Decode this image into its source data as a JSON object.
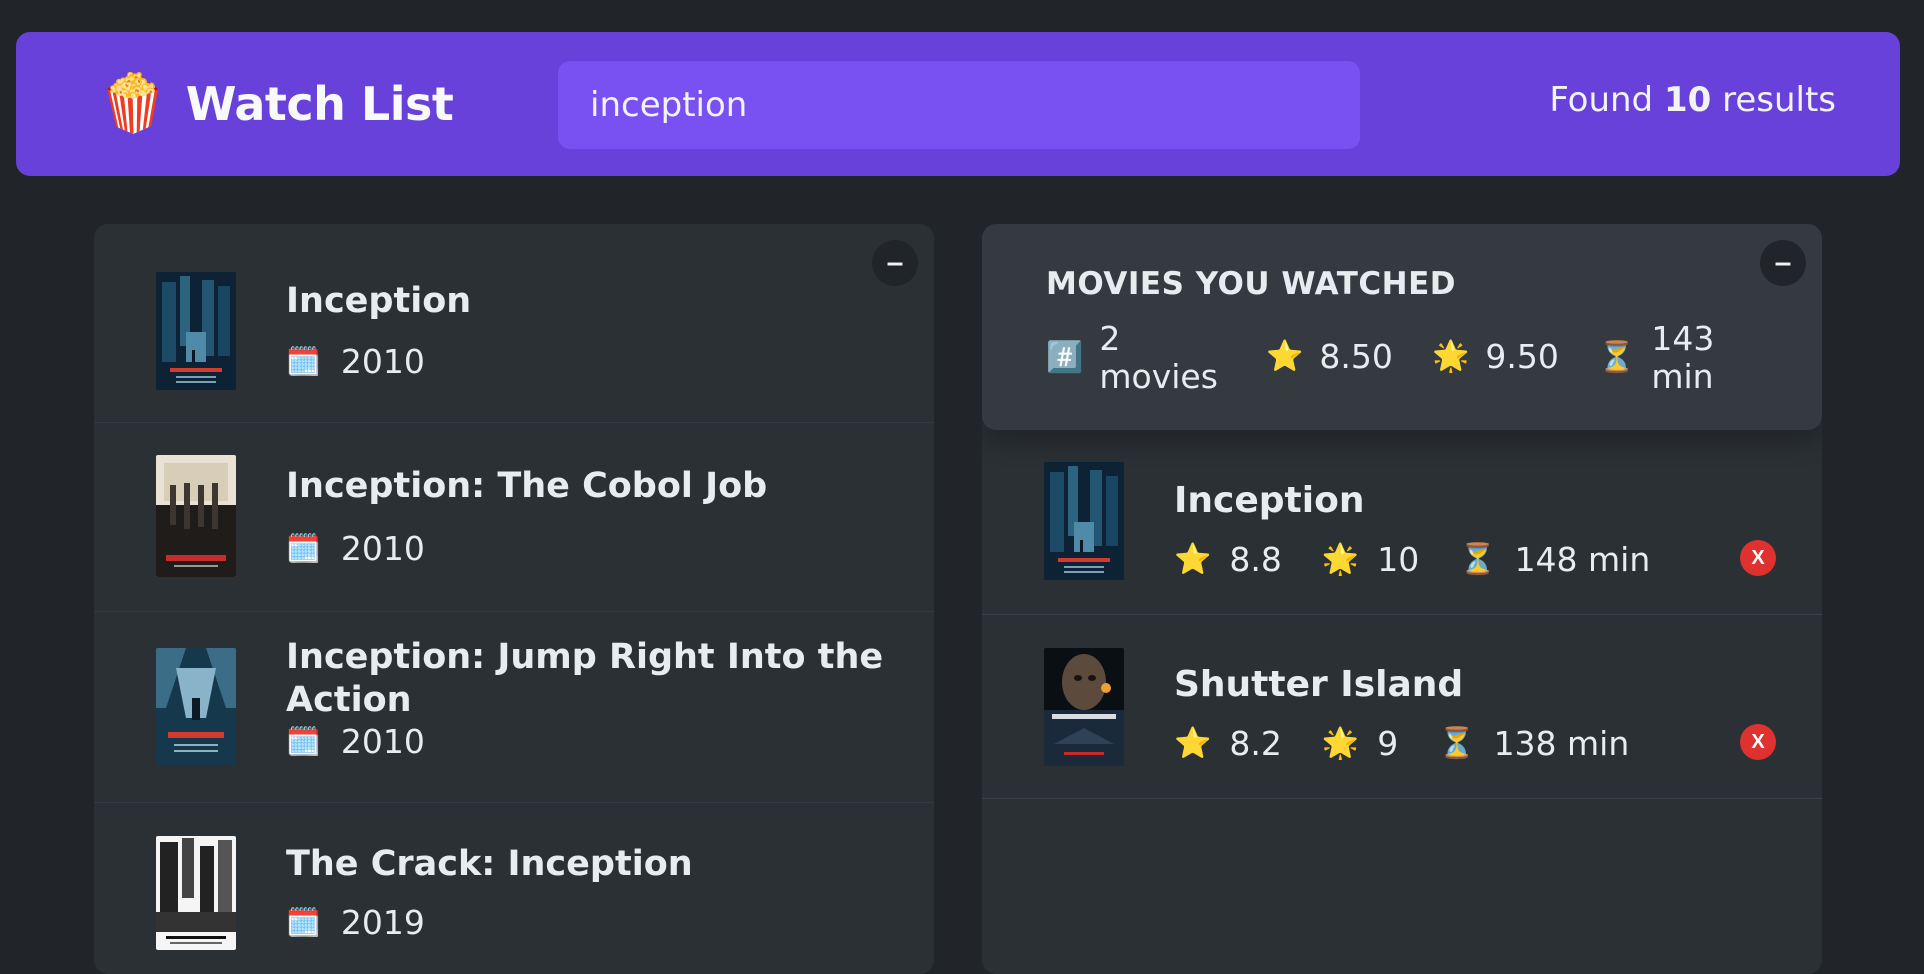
{
  "nav": {
    "logo_emoji": "🍿",
    "title": "Watch List",
    "search_value": "inception",
    "search_placeholder": "Search movies...",
    "results_prefix": "Found",
    "results_count": "10",
    "results_suffix": "results"
  },
  "colors": {
    "background": "#212529",
    "nav": "#6741d9",
    "search": "#7950f2",
    "box": "#2b3035",
    "summary": "#343a40",
    "delete": "#e03131"
  },
  "toggle_label": "–",
  "search_results": [
    {
      "title": "Inception",
      "year_icon": "🗓️",
      "year": "2010",
      "poster": "inception-poster"
    },
    {
      "title": "Inception: The Cobol Job",
      "year_icon": "🗓️",
      "year": "2010",
      "poster": "cobol-job-poster"
    },
    {
      "title": "Inception: Jump Right Into the Action",
      "year_icon": "🗓️",
      "year": "2010",
      "poster": "jump-right-poster"
    },
    {
      "title": "The Crack: Inception",
      "year_icon": "🗓️",
      "year": "2019",
      "poster": "crack-poster"
    }
  ],
  "summary": {
    "heading": "MOVIES YOU WATCHED",
    "count_icon": "#️⃣",
    "count_value": "2",
    "count_unit": "movies",
    "imdb_icon": "⭐️",
    "imdb_avg": "8.50",
    "user_icon": "🌟",
    "user_avg": "9.50",
    "runtime_icon": "⏳",
    "runtime_value": "143",
    "runtime_unit": "min"
  },
  "watched": [
    {
      "title": "Inception",
      "imdb_icon": "⭐️",
      "imdb": "8.8",
      "user_icon": "🌟",
      "user": "10",
      "runtime_icon": "⏳",
      "runtime": "148 min",
      "delete_label": "X",
      "poster": "inception-poster"
    },
    {
      "title": "Shutter Island",
      "imdb_icon": "⭐️",
      "imdb": "8.2",
      "user_icon": "🌟",
      "user": "9",
      "runtime_icon": "⏳",
      "runtime": "138 min",
      "delete_label": "X",
      "poster": "shutter-island-poster"
    }
  ]
}
